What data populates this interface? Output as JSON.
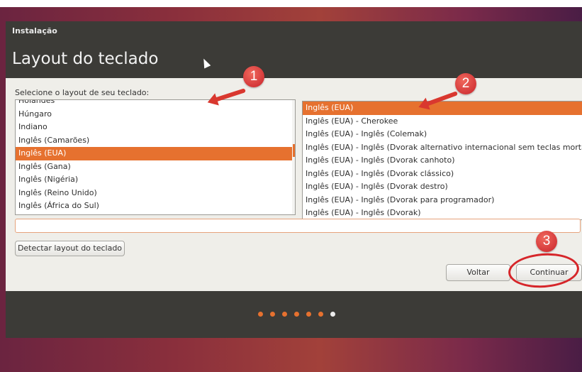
{
  "window": {
    "title": "Instalação",
    "page_title": "Layout do teclado"
  },
  "prompt": "Selecione o layout de seu teclado:",
  "layouts_left": [
    {
      "label": "Holandês",
      "selected": false
    },
    {
      "label": "Húngaro",
      "selected": false
    },
    {
      "label": "Indiano",
      "selected": false
    },
    {
      "label": "Inglês (Camarões)",
      "selected": false
    },
    {
      "label": "Inglês (EUA)",
      "selected": true
    },
    {
      "label": "Inglês (Gana)",
      "selected": false
    },
    {
      "label": "Inglês (Nigéria)",
      "selected": false
    },
    {
      "label": "Inglês (Reino Unido)",
      "selected": false
    },
    {
      "label": "Inglês (África do Sul)",
      "selected": false
    }
  ],
  "variants_right": [
    {
      "label": "Inglês (EUA)",
      "selected": true
    },
    {
      "label": "Inglês (EUA) - Cherokee",
      "selected": false
    },
    {
      "label": "Inglês (EUA) - Inglês (Colemak)",
      "selected": false
    },
    {
      "label": "Inglês (EUA) - Inglês (Dvorak alternativo internacional sem teclas mortas)",
      "selected": false
    },
    {
      "label": "Inglês (EUA) - Inglês (Dvorak canhoto)",
      "selected": false
    },
    {
      "label": "Inglês (EUA) - Inglês (Dvorak clássico)",
      "selected": false
    },
    {
      "label": "Inglês (EUA) - Inglês (Dvorak destro)",
      "selected": false
    },
    {
      "label": "Inglês (EUA) - Inglês (Dvorak para programador)",
      "selected": false
    },
    {
      "label": "Inglês (EUA) - Inglês (Dvorak)",
      "selected": false
    }
  ],
  "test_input": {
    "value": "",
    "placeholder": ""
  },
  "buttons": {
    "detect": "Detectar layout do teclado",
    "back": "Voltar",
    "continue": "Continuar"
  },
  "progress": {
    "total_steps": 7,
    "current_step": 7
  },
  "annotations": {
    "a1": "1",
    "a2": "2",
    "a3": "3"
  },
  "colors": {
    "accent": "#e6712f",
    "annotation_red": "#d9382f",
    "title_bar": "#3c3b37"
  }
}
